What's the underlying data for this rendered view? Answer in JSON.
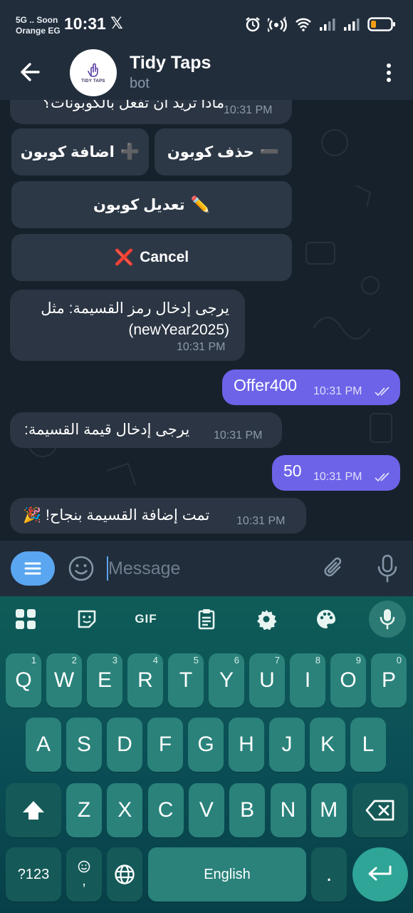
{
  "status_bar": {
    "carrier_line1": "5G .. Soon",
    "carrier_line2": "Orange EG",
    "time": "10:31",
    "x_logo": "𝕏",
    "icons": [
      "alarm-icon",
      "hotspot-icon",
      "wifi-icon",
      "signal-icon",
      "signal-icon",
      "battery-icon"
    ],
    "hotspot_badge": "1"
  },
  "header": {
    "title": "Tidy Taps",
    "subtitle": "bot",
    "avatar_text": "TIDY TAPS"
  },
  "messages": {
    "partial_question": "ماذا تريد أن تفعل بالكوبونات؟",
    "partial_time": "10:31 PM",
    "inline_keyboard": {
      "delete_coupon": "حذف كوبون",
      "delete_glyph": "➖",
      "add_coupon": "اضافة كوبون",
      "add_glyph": "➕",
      "edit_coupon": "تعديل كوبون",
      "edit_glyph": "✏️",
      "cancel": "Cancel",
      "cancel_glyph": "❌"
    },
    "m1_line1": "يرجى إدخال رمز القسيمة: مثل",
    "m1_line2": "(newYear2025)",
    "m1_time": "10:31 PM",
    "m2_text": "Offer400",
    "m2_time": "10:31 PM",
    "m3_text": "يرجى إدخال قيمة القسيمة:",
    "m3_time": "10:31 PM",
    "m4_text": "50",
    "m4_time": "10:31 PM",
    "m5_text": "تمت إضافة القسيمة بنجاح! 🎉",
    "m5_time": "10:31 PM"
  },
  "input": {
    "placeholder": "Message"
  },
  "keyboard": {
    "toolbar": {
      "gif_label": "GIF"
    },
    "row1": [
      {
        "k": "Q",
        "h": "1"
      },
      {
        "k": "W",
        "h": "2"
      },
      {
        "k": "E",
        "h": "3"
      },
      {
        "k": "R",
        "h": "4"
      },
      {
        "k": "T",
        "h": "5"
      },
      {
        "k": "Y",
        "h": "6"
      },
      {
        "k": "U",
        "h": "7"
      },
      {
        "k": "I",
        "h": "8"
      },
      {
        "k": "O",
        "h": "9"
      },
      {
        "k": "P",
        "h": "0"
      }
    ],
    "row2": [
      "A",
      "S",
      "D",
      "F",
      "G",
      "H",
      "J",
      "K",
      "L"
    ],
    "row3": [
      "Z",
      "X",
      "C",
      "V",
      "B",
      "N",
      "M"
    ],
    "symbols_key": "?123",
    "emoji_comma_key": ",",
    "space_label": "English",
    "period_key": "."
  },
  "colors": {
    "outgoing_bubble": "#6c63e8",
    "incoming_bubble": "#2b3543",
    "accent": "#5aa6f0",
    "keyboard_key": "#2a827b"
  }
}
